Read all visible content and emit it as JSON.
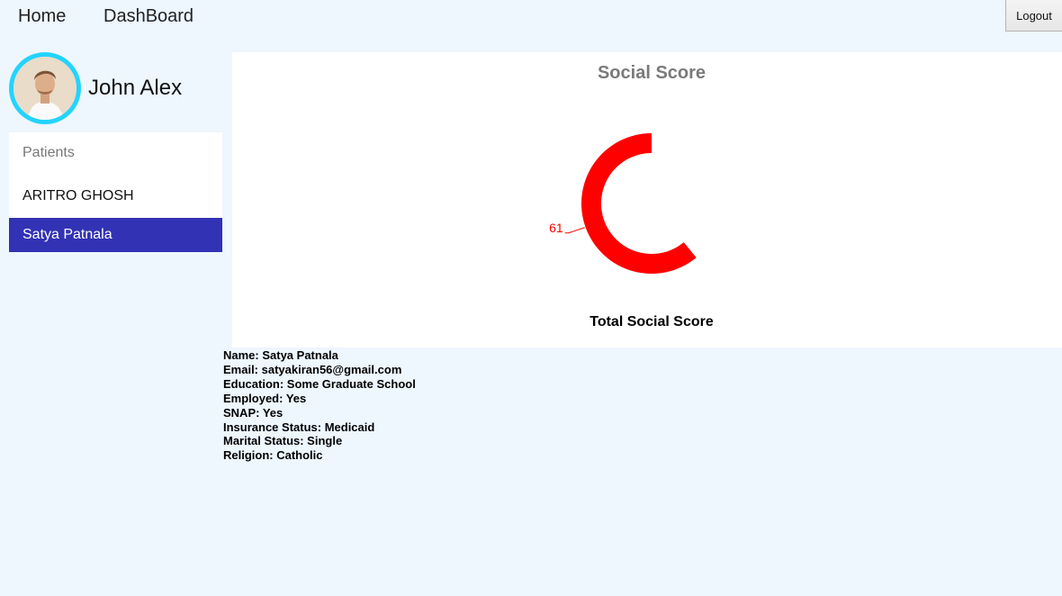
{
  "nav": {
    "home_label": "Home",
    "dashboard_label": "DashBoard",
    "logout_label": "Logout"
  },
  "user": {
    "name": "John Alex",
    "avatar_icon": "user-avatar-photo"
  },
  "patients": {
    "header": "Patients",
    "items": [
      {
        "label": "ARITRO GHOSH",
        "selected": false
      },
      {
        "label": "Satya Patnala",
        "selected": true
      }
    ],
    "selected_color": "#3232b4"
  },
  "chart_data": {
    "type": "pie",
    "title": "Social Score",
    "subtitle": "Total Social Score",
    "series": [
      {
        "value": 61,
        "label": "61",
        "color": "#ff0000"
      }
    ]
  },
  "details": {
    "name": "Name: Satya Patnala",
    "email": "Email: satyakiran56@gmail.com",
    "education": "Education: Some Graduate School",
    "employed": "Employed: Yes",
    "snap": "SNAP: Yes",
    "insurance": "Insurance Status: Medicaid",
    "marital": "Marital Status: Single",
    "religion": "Religion: Catholic"
  },
  "colors": {
    "background": "#eef6fe",
    "avatar_ring": "#22d4ff",
    "chart_series": "#ff0000"
  }
}
